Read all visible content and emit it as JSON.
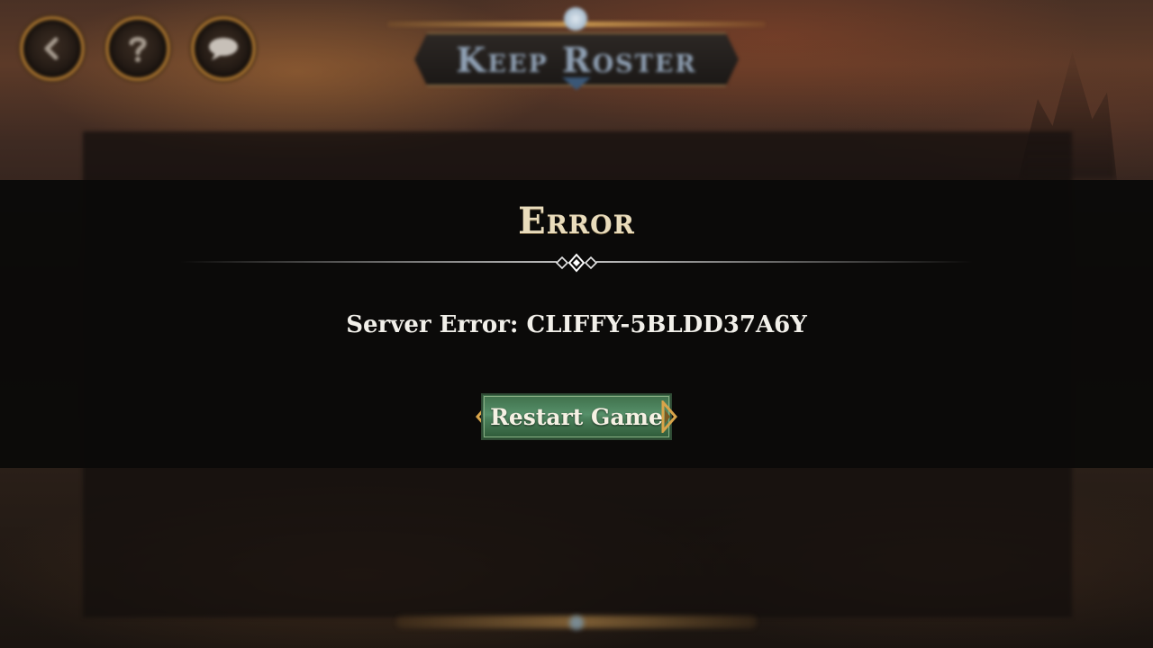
{
  "header": {
    "title": "Keep Roster",
    "buttons": [
      {
        "name": "back",
        "icon": "chevron-left-icon"
      },
      {
        "name": "help",
        "icon": "question-mark-icon"
      },
      {
        "name": "chat",
        "icon": "chat-bubble-icon"
      }
    ]
  },
  "error_dialog": {
    "title": "Error",
    "message": "Server Error: CLIFFY-5BLDD37A6Y",
    "button_label": "Restart Game"
  },
  "colors": {
    "title": "#e9dcbc",
    "message": "#f1efe9",
    "button_green": "#4a7f5a",
    "gold_trim": "#c8964e"
  }
}
